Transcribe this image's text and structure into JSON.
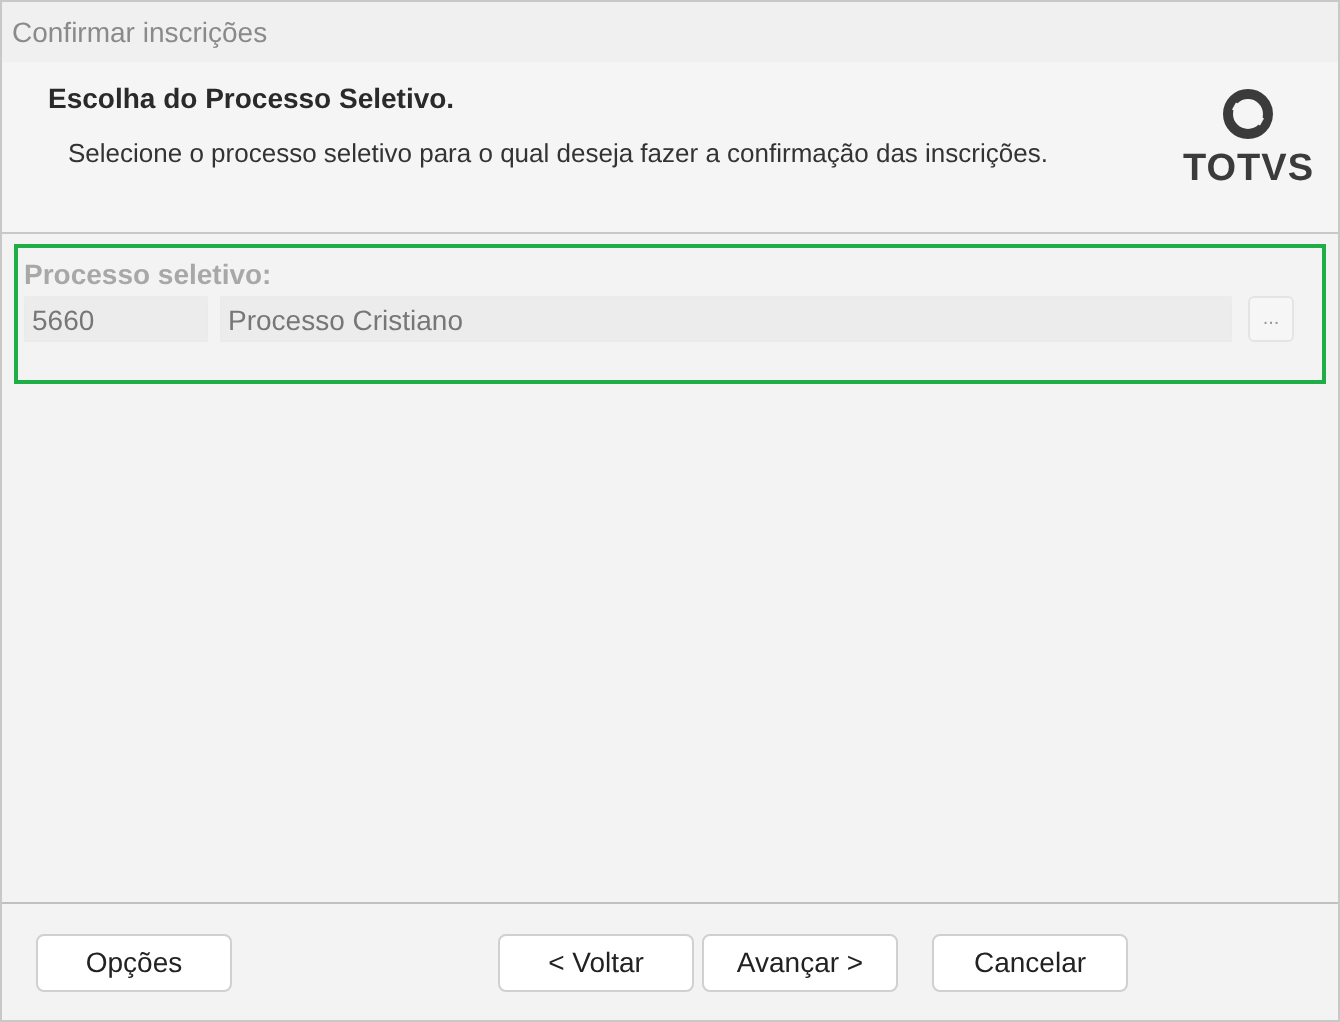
{
  "window": {
    "title": "Confirmar inscrições"
  },
  "header": {
    "title": "Escolha do Processo Seletivo.",
    "description": "Selecione o processo seletivo para o qual deseja fazer a confirmação das inscrições.",
    "logo_text": "TOTVS"
  },
  "group": {
    "highlighted": true,
    "label": "Processo seletivo:",
    "disabled": true,
    "code": "5660",
    "name": "Processo Cristiano",
    "lookup_button": "..."
  },
  "buttons": [
    {
      "label": "Opções",
      "kind": "left"
    },
    {
      "label": "< Voltar",
      "kind": "nav"
    },
    {
      "label": "Avançar >",
      "kind": "nav"
    },
    {
      "label": "Cancelar",
      "kind": "cancel"
    }
  ]
}
